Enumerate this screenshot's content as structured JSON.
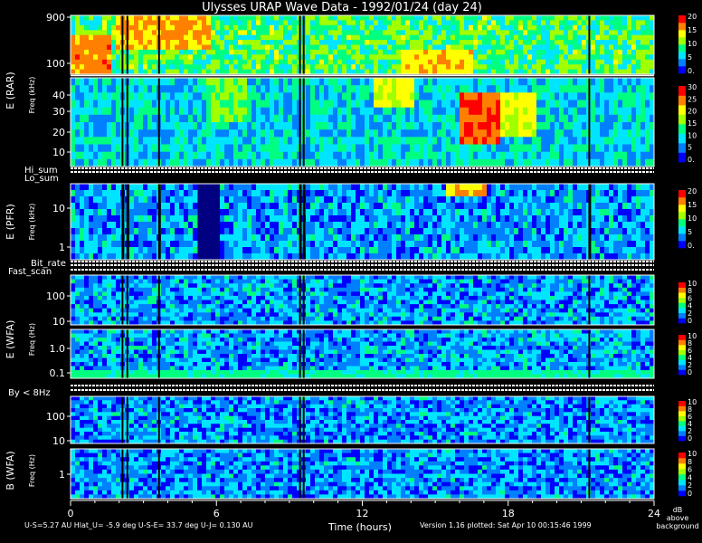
{
  "title": "Ulysses URAP Wave Data - 1992/01/24 (day 24)",
  "chart_data": {
    "type": "heatmap",
    "x_label": "Time (hours)",
    "x_ticks": [
      "0",
      "6",
      "12",
      "18",
      "24"
    ],
    "x_range": [
      0,
      24
    ],
    "panels": [
      {
        "id": "rar-high",
        "y_ticks": [
          "900",
          "100"
        ],
        "y_range": [
          60,
          900
        ],
        "y_scale": "log",
        "cbar_ticks": [
          "20",
          "15",
          "10",
          "5",
          "0."
        ]
      },
      {
        "id": "rar-low",
        "y_ticks": [
          "40",
          "30",
          "20",
          "10"
        ],
        "y_range": [
          2,
          60
        ],
        "y_scale": "linear",
        "cbar_ticks": [
          "30",
          "25",
          "20",
          "15",
          "10",
          "5",
          "0."
        ]
      },
      {
        "id": "pfr",
        "y_ticks": [
          "10",
          "1"
        ],
        "y_range": [
          0.4,
          30
        ],
        "y_scale": "log",
        "cbar_ticks": [
          "20",
          "15",
          "10",
          "5",
          "0."
        ]
      },
      {
        "id": "wfa-e-high",
        "y_ticks": [
          "100",
          "10"
        ],
        "y_range": [
          8,
          400
        ],
        "y_scale": "log",
        "cbar_ticks": [
          "10",
          "8",
          "6",
          "4",
          "2",
          "0"
        ]
      },
      {
        "id": "wfa-e-low",
        "y_ticks": [
          "1.0",
          "0.1"
        ],
        "y_range": [
          0.08,
          5
        ],
        "y_scale": "log",
        "cbar_ticks": [
          "10",
          "8",
          "6",
          "4",
          "2",
          "0"
        ]
      },
      {
        "id": "wfa-b-high",
        "y_ticks": [
          "100",
          "10"
        ],
        "y_range": [
          8,
          400
        ],
        "y_scale": "log",
        "cbar_ticks": [
          "10",
          "8",
          "6",
          "4",
          "2",
          "0"
        ]
      },
      {
        "id": "wfa-b-low",
        "y_ticks": [
          "1"
        ],
        "y_range": [
          0.2,
          5
        ],
        "y_scale": "log",
        "cbar_ticks": [
          "10",
          "8",
          "6",
          "4",
          "2",
          "0"
        ]
      }
    ],
    "group_labels": {
      "rar": "E (RAR)",
      "pfr": "E (PFR)",
      "wfa_e": "E (WFA)",
      "wfa_b": "B (WFA)"
    },
    "freq_labels": {
      "khz": "Freq (kHz)",
      "hz": "Freq (Hz)"
    },
    "strip_labels": [
      "Hi_sum",
      "Lo_sum",
      "Bit_rate",
      "Fast_scan",
      "By < 8Hz"
    ],
    "colorbar_units": [
      "dB",
      "above",
      "background"
    ],
    "colors": [
      "#000080",
      "#0000ff",
      "#0080ff",
      "#00e5ff",
      "#00ff80",
      "#a0ff00",
      "#ffff00",
      "#ff8000",
      "#ff0000"
    ]
  },
  "footer": {
    "left": "U-S=5.27 AU   Hlat_U= -5.9 deg   U-S-E= 33.7 deg   U-J= 0.130 AU",
    "right": "Version 1.16 plotted: Sat Apr 10 00:15:46 1999"
  }
}
